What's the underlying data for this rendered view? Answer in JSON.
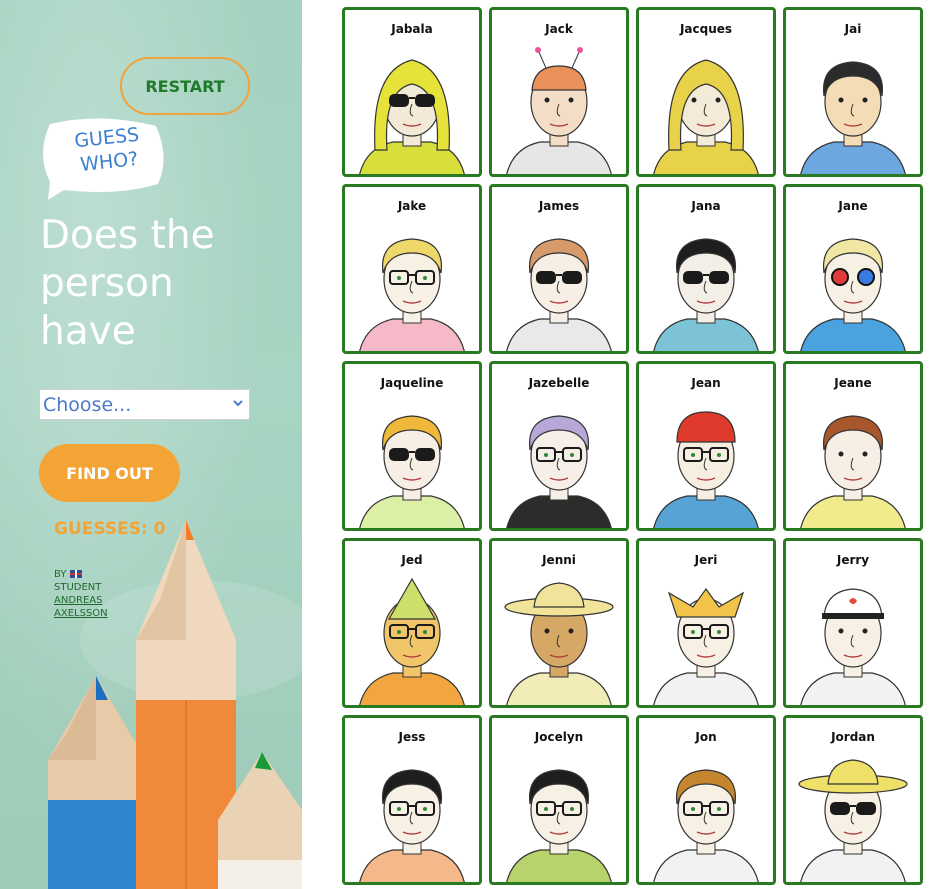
{
  "sidebar": {
    "restart_label": "RESTART",
    "logo": {
      "line1": "GUESS",
      "line2": "WHO?"
    },
    "question": "Does the person have",
    "select": {
      "value": "Choose..."
    },
    "find_label": "FIND OUT",
    "guesses_label": "GUESSES: 0",
    "byline": {
      "by": "BY",
      "student": "STUDENT",
      "author1": "ANDREAS",
      "author2": "AXELSSON"
    }
  },
  "colors": {
    "accent": "#f4a335",
    "card_border": "#2a7a22",
    "restart_text": "#1f7a2a",
    "logo_text": "#3d7fd0"
  },
  "cards": [
    {
      "name": "Jabala",
      "hair": "#e5e23a",
      "skin": "#f3e9d7",
      "shirt": "#d8df3a",
      "glasses": "sun",
      "hat": "hood"
    },
    {
      "name": "Jack",
      "hair": "#e8915b",
      "skin": "#f4ddc6",
      "shirt": "#e6e6e6",
      "glasses": "none",
      "hat": "antenna"
    },
    {
      "name": "Jacques",
      "hair": "#e7d24a",
      "skin": "#f3ead7",
      "shirt": "#e7d24a",
      "glasses": "none",
      "hat": "hood"
    },
    {
      "name": "Jai",
      "hair": "#2b2b2b",
      "skin": "#f4ddb6",
      "shirt": "#6ea6e0",
      "glasses": "none",
      "hat": "none"
    },
    {
      "name": "Jake",
      "hair": "#efd86b",
      "skin": "#f7f0e4",
      "shirt": "#f6b9c8",
      "glasses": "round",
      "hat": "none"
    },
    {
      "name": "James",
      "hair": "#d79b6b",
      "skin": "#f7efe6",
      "shirt": "#e9e9e9",
      "glasses": "sun",
      "hat": "none"
    },
    {
      "name": "Jana",
      "hair": "#1e1e1e",
      "skin": "#f4efe6",
      "shirt": "#7dc3d8",
      "glasses": "sun",
      "hat": "none"
    },
    {
      "name": "Jane",
      "hair": "#f1e6a4",
      "skin": "#f7f0e4",
      "shirt": "#4aa3de",
      "glasses": "3d",
      "hat": "none"
    },
    {
      "name": "Jaqueline",
      "hair": "#f0b83a",
      "skin": "#f7efe6",
      "shirt": "#dcefa7",
      "glasses": "sun",
      "hat": "none"
    },
    {
      "name": "Jazebelle",
      "hair": "#b7a8d8",
      "skin": "#f5efe7",
      "shirt": "#2c2c2c",
      "glasses": "round",
      "hat": "none"
    },
    {
      "name": "Jean",
      "hair": "#df3b2d",
      "skin": "#f7eee2",
      "shirt": "#58a3d6",
      "glasses": "round",
      "hat": "beanie"
    },
    {
      "name": "Jeane",
      "hair": "#a8562c",
      "skin": "#f7efe6",
      "shirt": "#f1eb8e",
      "glasses": "none",
      "hat": "none"
    },
    {
      "name": "Jed",
      "hair": "#cddf6a",
      "skin": "#f1c56a",
      "shirt": "#f1a640",
      "glasses": "round",
      "hat": "cone"
    },
    {
      "name": "Jenni",
      "hair": "#f1e39a",
      "skin": "#d6a865",
      "shirt": "#f2ecb8",
      "glasses": "none",
      "hat": "wide"
    },
    {
      "name": "Jeri",
      "hair": "#f2c54a",
      "skin": "#f7f0e4",
      "shirt": "#f2f2f2",
      "glasses": "round",
      "hat": "jester"
    },
    {
      "name": "Jerry",
      "hair": "#ffffff",
      "skin": "#f7f0e4",
      "shirt": "#f2f2f2",
      "glasses": "none",
      "hat": "cap"
    },
    {
      "name": "Jess",
      "hair": "#1e1e1e",
      "skin": "#f7f0e4",
      "shirt": "#f4b88a",
      "glasses": "round",
      "hat": "none"
    },
    {
      "name": "Jocelyn",
      "hair": "#1e1e1e",
      "skin": "#f7f0e4",
      "shirt": "#b6d46b",
      "glasses": "round",
      "hat": "none"
    },
    {
      "name": "Jon",
      "hair": "#c5862f",
      "skin": "#f7f0e4",
      "shirt": "#f2f2f2",
      "glasses": "round",
      "hat": "none"
    },
    {
      "name": "Jordan",
      "hair": "#efe06a",
      "skin": "#f7f0e4",
      "shirt": "#f2f2f2",
      "glasses": "sun",
      "hat": "wide"
    }
  ]
}
